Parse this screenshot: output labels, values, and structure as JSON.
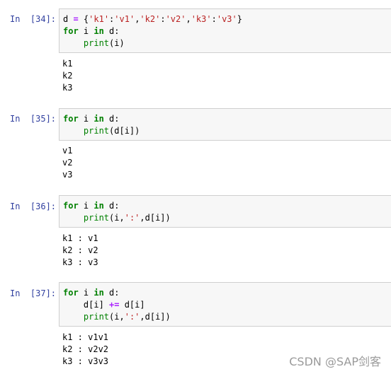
{
  "cells": [
    {
      "prompt": "In  [34]:",
      "input": [
        [
          {
            "t": "d ",
            "c": ""
          },
          {
            "t": "=",
            "c": "op"
          },
          {
            "t": " {",
            "c": ""
          },
          {
            "t": "'k1'",
            "c": "st"
          },
          {
            "t": ":",
            "c": ""
          },
          {
            "t": "'v1'",
            "c": "st"
          },
          {
            "t": ",",
            "c": ""
          },
          {
            "t": "'k2'",
            "c": "st"
          },
          {
            "t": ":",
            "c": ""
          },
          {
            "t": "'v2'",
            "c": "st"
          },
          {
            "t": ",",
            "c": ""
          },
          {
            "t": "'k3'",
            "c": "st"
          },
          {
            "t": ":",
            "c": ""
          },
          {
            "t": "'v3'",
            "c": "st"
          },
          {
            "t": "}",
            "c": ""
          }
        ],
        [
          {
            "t": "for",
            "c": "kw"
          },
          {
            "t": " i ",
            "c": ""
          },
          {
            "t": "in",
            "c": "kw"
          },
          {
            "t": " d:",
            "c": ""
          }
        ],
        [
          {
            "t": "    ",
            "c": ""
          },
          {
            "t": "print",
            "c": "bi"
          },
          {
            "t": "(i)",
            "c": ""
          }
        ]
      ],
      "output": [
        "k1",
        "k2",
        "k3"
      ]
    },
    {
      "prompt": "In  [35]:",
      "input": [
        [
          {
            "t": "for",
            "c": "kw"
          },
          {
            "t": " i ",
            "c": ""
          },
          {
            "t": "in",
            "c": "kw"
          },
          {
            "t": " d:",
            "c": ""
          }
        ],
        [
          {
            "t": "    ",
            "c": ""
          },
          {
            "t": "print",
            "c": "bi"
          },
          {
            "t": "(d[i])",
            "c": ""
          }
        ]
      ],
      "output": [
        "v1",
        "v2",
        "v3"
      ]
    },
    {
      "prompt": "In  [36]:",
      "input": [
        [
          {
            "t": "for",
            "c": "kw"
          },
          {
            "t": " i ",
            "c": ""
          },
          {
            "t": "in",
            "c": "kw"
          },
          {
            "t": " d:",
            "c": ""
          }
        ],
        [
          {
            "t": "    ",
            "c": ""
          },
          {
            "t": "print",
            "c": "bi"
          },
          {
            "t": "(i,",
            "c": ""
          },
          {
            "t": "':'",
            "c": "st"
          },
          {
            "t": ",d[i])",
            "c": ""
          }
        ]
      ],
      "output": [
        "k1 : v1",
        "k2 : v2",
        "k3 : v3"
      ]
    },
    {
      "prompt": "In  [37]:",
      "input": [
        [
          {
            "t": "for",
            "c": "kw"
          },
          {
            "t": " i ",
            "c": ""
          },
          {
            "t": "in",
            "c": "kw"
          },
          {
            "t": " d:",
            "c": ""
          }
        ],
        [
          {
            "t": "    d[i] ",
            "c": ""
          },
          {
            "t": "+=",
            "c": "op"
          },
          {
            "t": " d[i]",
            "c": ""
          }
        ],
        [
          {
            "t": "    ",
            "c": ""
          },
          {
            "t": "print",
            "c": "bi"
          },
          {
            "t": "(i,",
            "c": ""
          },
          {
            "t": "':'",
            "c": "st"
          },
          {
            "t": ",d[i])",
            "c": ""
          }
        ]
      ],
      "output": [
        "k1 : v1v1",
        "k2 : v2v2",
        "k3 : v3v3"
      ]
    }
  ],
  "watermark": "CSDN @SAP剑客"
}
